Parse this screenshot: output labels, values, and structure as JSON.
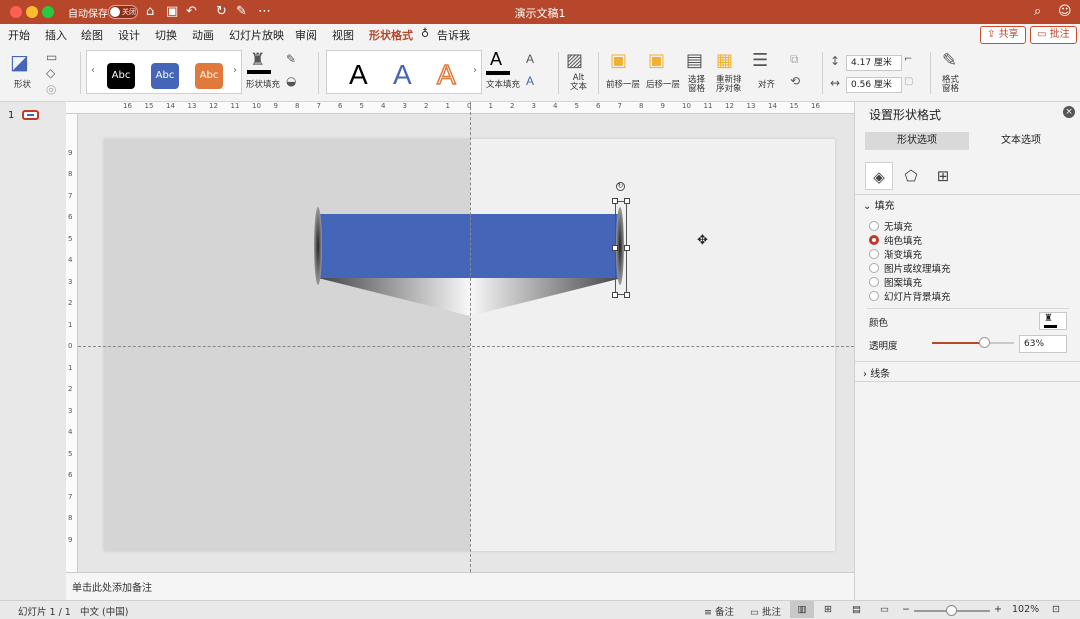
{
  "window": {
    "title": "演示文稿1",
    "autosave_label": "自动保存",
    "autosave_state": "关闭"
  },
  "menu": {
    "tabs": [
      "开始",
      "插入",
      "绘图",
      "设计",
      "切换",
      "动画",
      "幻灯片放映",
      "审阅",
      "视图",
      "形状格式"
    ],
    "tell_me": "告诉我",
    "share": "共享",
    "comments": "批注"
  },
  "ribbon": {
    "shapes_label": "形状",
    "style_swatches": [
      {
        "text": "Abc",
        "color": "#000000"
      },
      {
        "text": "Abc",
        "color": "#4566b8"
      },
      {
        "text": "Abc",
        "color": "#e07a3c"
      }
    ],
    "shape_fill_label": "形状填充",
    "wordart": [
      {
        "text": "A",
        "color": "#000000"
      },
      {
        "text": "A",
        "color": "#4566b8"
      },
      {
        "text": "A",
        "color": "#e07a3c"
      }
    ],
    "text_fill_label": "文本填充",
    "alt_text_label": "Alt\n文本",
    "bring_forward": "前移一层",
    "send_backward": "后移一层",
    "selection_pane": "选择\n窗格",
    "reorder": "重新排\n序对象",
    "align": "对齐",
    "height": "4.17 厘米",
    "width": "0.56 厘米",
    "format_pane": "格式\n窗格"
  },
  "slide_panel": {
    "slide_number": "1"
  },
  "notes": {
    "placeholder": "单击此处添加备注"
  },
  "format_pane": {
    "title": "设置形状格式",
    "tabs": [
      "形状选项",
      "文本选项"
    ],
    "fill_section": "填充",
    "fill_options": [
      "无填充",
      "纯色填充",
      "渐变填充",
      "图片或纹理填充",
      "图案填充",
      "幻灯片背景填充"
    ],
    "fill_selected": "纯色填充",
    "color_label": "颜色",
    "transparency_label": "透明度",
    "transparency_value": "63%",
    "transparency": 0.63,
    "line_section": "线条"
  },
  "statusbar": {
    "slide_info": "幻灯片 1 / 1",
    "language": "中文 (中国)",
    "notes": "备注",
    "comments": "批注",
    "zoom": "102%"
  },
  "colors": {
    "accent": "#b7472a",
    "banner": "#4566b8"
  }
}
